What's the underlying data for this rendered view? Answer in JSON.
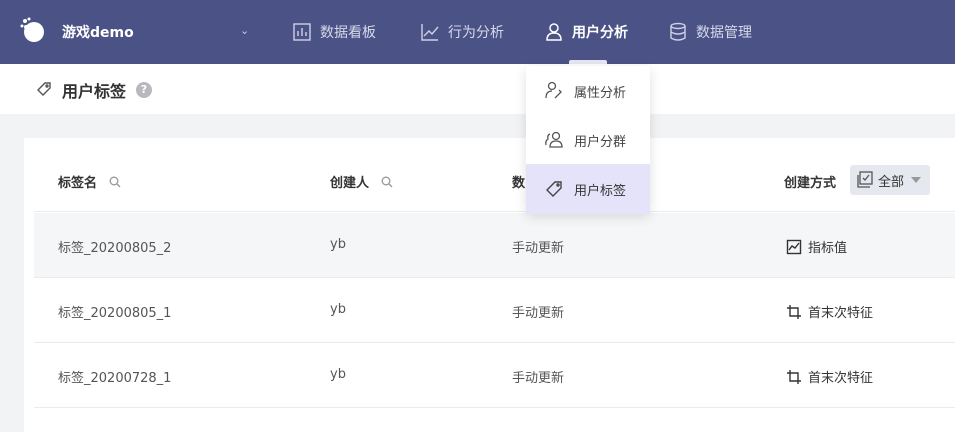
{
  "app": {
    "name": "游戏demo"
  },
  "nav": {
    "items": [
      {
        "label": "数据看板"
      },
      {
        "label": "行为分析"
      },
      {
        "label": "用户分析"
      },
      {
        "label": "数据管理"
      }
    ],
    "active": "用户分析"
  },
  "page": {
    "title": "用户标签",
    "help": "?"
  },
  "dropdown": {
    "items": [
      {
        "label": "属性分析"
      },
      {
        "label": "用户分群"
      },
      {
        "label": "用户标签"
      }
    ],
    "selected": "用户标签"
  },
  "table": {
    "columns": [
      {
        "label": "标签名"
      },
      {
        "label": "创建人"
      },
      {
        "label": "数"
      },
      {
        "label": "创建方式"
      }
    ],
    "filter": {
      "value": "全部"
    },
    "rows": [
      {
        "name": "标签_20200805_2",
        "creator": "yb",
        "update": "手动更新",
        "method": "指标值",
        "method_icon": "chart-icon"
      },
      {
        "name": "标签_20200805_1",
        "creator": "yb",
        "update": "手动更新",
        "method": "首末次特征",
        "method_icon": "crop-icon"
      },
      {
        "name": "标签_20200728_1",
        "creator": "yb",
        "update": "手动更新",
        "method": "首末次特征",
        "method_icon": "crop-icon"
      }
    ]
  },
  "colors": {
    "nav_bg": "#4b5386",
    "selected_bg": "#e4e3fa"
  }
}
